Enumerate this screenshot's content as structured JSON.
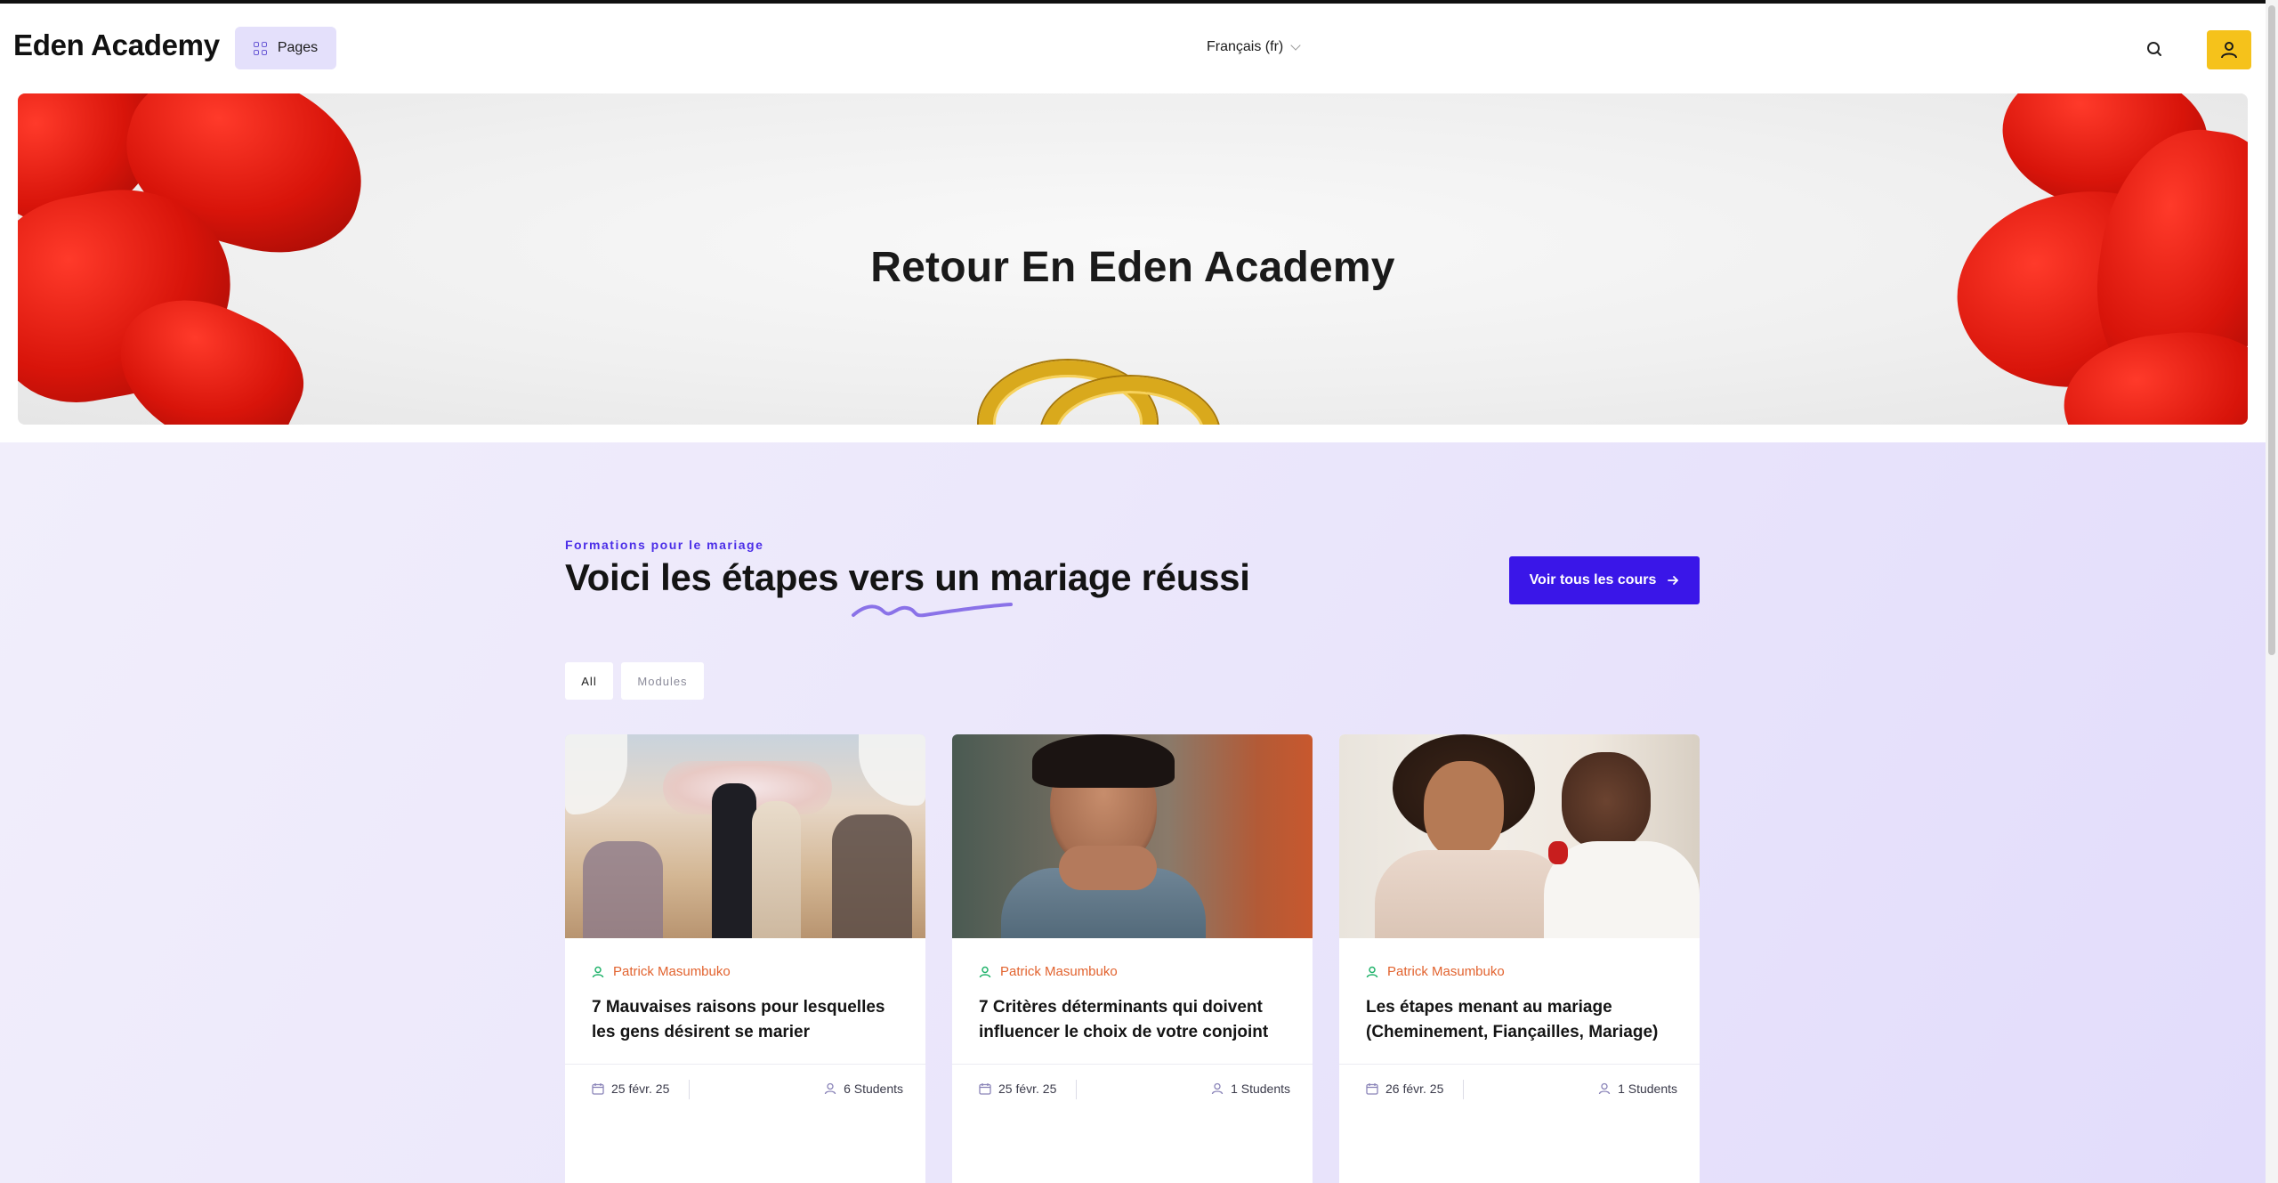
{
  "header": {
    "brand": "Eden Academy",
    "pages_label": "Pages",
    "language": "Français (fr)"
  },
  "hero": {
    "title": "Retour En Eden Academy"
  },
  "courses": {
    "eyebrow": "Formations pour le mariage",
    "title": "Voici les étapes vers un mariage réussi",
    "all_courses_label": "Voir tous les cours",
    "filters": [
      "All",
      "Modules"
    ],
    "items": [
      {
        "author": "Patrick Masumbuko",
        "title": "7 Mauvaises raisons pour lesquelles les gens désirent se marier",
        "date": "25 févr. 25",
        "students": "6 Students"
      },
      {
        "author": "Patrick Masumbuko",
        "title": "7 Critères déterminants qui doivent influencer le choix de votre conjoint",
        "date": "25 févr. 25",
        "students": "1 Students"
      },
      {
        "author": "Patrick Masumbuko",
        "title": "Les étapes menant au mariage (Cheminement, Fiançailles, Mariage)",
        "date": "26 févr. 25",
        "students": "1 Students"
      }
    ]
  },
  "colors": {
    "accent": "#3a16e8",
    "user_button": "#f5c21b",
    "author": "#e2632f",
    "pages_button": "#e4e0fb"
  },
  "icons": [
    "grid-icon",
    "chevron-down-icon",
    "search-icon",
    "user-icon",
    "arrow-right-icon",
    "person-icon",
    "calendar-icon"
  ]
}
